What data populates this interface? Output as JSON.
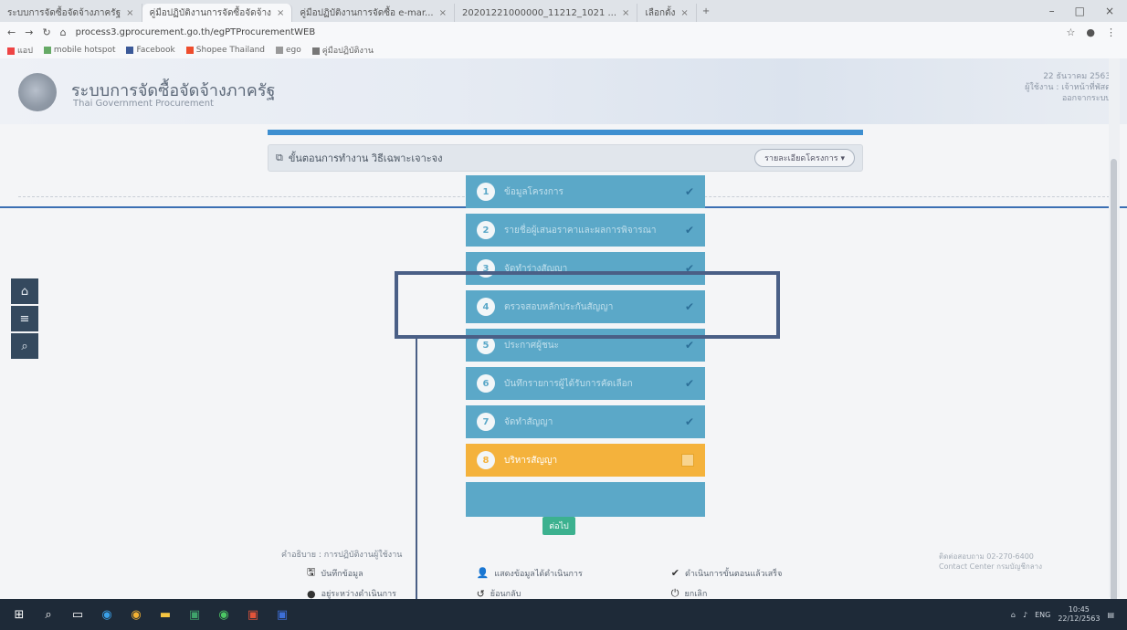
{
  "browser": {
    "tabs": [
      {
        "label": "ระบบการจัดซื้อจัดจ้างภาครัฐ",
        "active": false
      },
      {
        "label": "คู่มือปฏิบัติงานการจัดซื้อจัดจ้าง",
        "active": true
      },
      {
        "label": "คู่มือปฏิบัติงานการจัดซื้อ e-mar...",
        "active": false
      },
      {
        "label": "20201221000000_11212_1021 ...",
        "active": false
      },
      {
        "label": "เลือกตั้ง",
        "active": false
      }
    ],
    "url": "process3.gprocurement.go.th/egPTProcurementWEB",
    "bookmarks": [
      "แอป",
      "mobile hotspot",
      "Facebook",
      "Shopee Thailand",
      "ego",
      "คู่มือปฏิบัติงาน"
    ]
  },
  "site": {
    "title": "ระบบการจัดซื้อจัดจ้างภาครัฐ",
    "subtitle": "Thai Government Procurement",
    "header_info": [
      "22 ธันวาคม 2563",
      "ผู้ใช้งาน : เจ้าหน้าที่พัสดุ",
      "ออกจากระบบ"
    ]
  },
  "panel": {
    "title": "ขั้นตอนการทำงาน วิธีเฉพาะเจาะจง",
    "select_label": "รายละเอียดโครงการ"
  },
  "steps": [
    {
      "num": "1",
      "label": "ข้อมูลโครงการ",
      "status": "done"
    },
    {
      "num": "2",
      "label": "รายชื่อผู้เสนอราคาและผลการพิจารณา",
      "status": "done"
    },
    {
      "num": "3",
      "label": "จัดทำร่างสัญญา",
      "status": "done"
    },
    {
      "num": "4",
      "label": "ตรวจสอบหลักประกันสัญญา",
      "status": "done"
    },
    {
      "num": "5",
      "label": "ประกาศผู้ชนะ",
      "status": "done"
    },
    {
      "num": "6",
      "label": "บันทึกรายการผู้ได้รับการคัดเลือก",
      "status": "done"
    },
    {
      "num": "7",
      "label": "จัดทำสัญญา",
      "status": "done"
    },
    {
      "num": "8",
      "label": "บริหารสัญญา",
      "status": "active"
    }
  ],
  "last_step_label": "",
  "next_button": "ต่อไป",
  "legend": {
    "header": "คำอธิบาย : การปฏิบัติงานผู้ใช้งาน",
    "items": [
      [
        "บันทึกข้อมูล",
        "แสดงข้อมูลได้ดำเนินการ",
        "ดำเนินการขั้นตอนแล้วเสร็จ"
      ],
      [
        "อยู่ระหว่างดำเนินการ",
        "ย้อนกลับ",
        "ยกเลิก"
      ]
    ]
  },
  "right_note": [
    "ติดต่อสอบถาม 02-270-6400",
    "Contact Center กรมบัญชีกลาง"
  ],
  "taskbar": {
    "time": "10:45",
    "date": "22/12/2563",
    "lang": "ENG"
  }
}
